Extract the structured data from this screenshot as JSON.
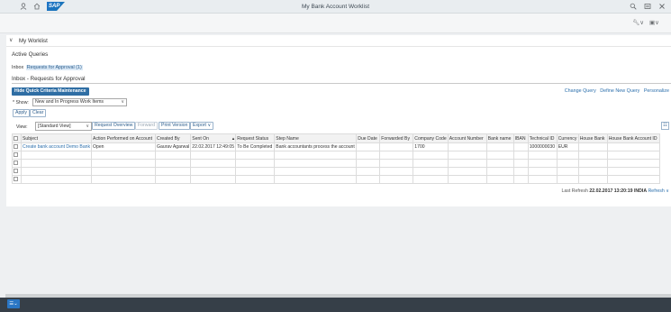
{
  "shell": {
    "title": "My Bank Account Worklist",
    "logo_text": "SAP"
  },
  "worklist": {
    "label": "My Worklist",
    "active_queries": "Active Queries",
    "inbox_prefix": "Inbox",
    "inbox_link": "Requests for Approval (1)",
    "inbox_title": "Inbox - Requests for Approval"
  },
  "criteria": {
    "hide_button": "Hide Quick Criteria Maintenance",
    "links": [
      "Change Query",
      "Define New Query",
      "Personalize"
    ],
    "show_label": "* Show:",
    "show_value": "New and In Progress Work Items",
    "apply": "Apply",
    "clear": "Clear"
  },
  "toolbar": {
    "view_label": "View:",
    "view_value": "[Standard View]",
    "request_overview": "Request Overview",
    "forward": "Forward",
    "print_version": "Print Version",
    "export": "Export"
  },
  "table": {
    "columns": [
      "Subject",
      "Action Performed on Account",
      "Created By",
      "Sent On",
      "Request Status",
      "Step Name",
      "Due Date",
      "Forwarded By",
      "Company Code",
      "Account Number",
      "Bank name",
      "IBAN",
      "Technical ID",
      "Currency",
      "House Bank",
      "House Bank Account ID"
    ],
    "rows": [
      [
        "Create bank account Demo Bank",
        "Open",
        "Gaurav Agarwal",
        "22.02.2017 12:49:05",
        "To Be Completed",
        "Bank accountants process the account",
        "",
        "",
        "1700",
        "",
        "",
        "",
        "1000000030",
        "EUR",
        "",
        ""
      ]
    ]
  },
  "refresh": {
    "label": "Last Refresh",
    "timestamp": "22.02.2017 13:20:19 INDIA",
    "link": "Refresh"
  },
  "icons": {
    "user": "user-icon",
    "home": "home-icon",
    "search": "search-icon",
    "settings": "settings-icon",
    "close": "close-icon"
  }
}
